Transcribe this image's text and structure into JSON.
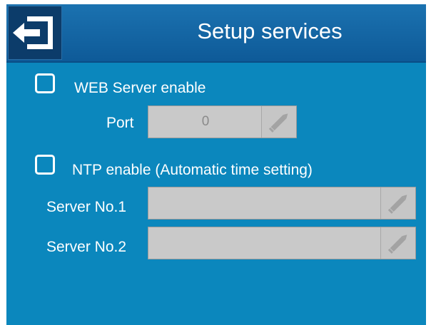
{
  "header": {
    "title": "Setup services",
    "back_icon": "exit-arrow-icon"
  },
  "web_server": {
    "checkbox_checked": false,
    "label": "WEB Server enable",
    "port_label": "Port",
    "port_value": "0"
  },
  "ntp": {
    "checkbox_checked": false,
    "label": "NTP enable (Automatic time setting)",
    "server1_label": "Server No.1",
    "server1_value": "",
    "server2_label": "Server No.2",
    "server2_value": ""
  },
  "icons": {
    "edit": "pencil-icon"
  },
  "colors": {
    "background": "#0b87bd",
    "header": "#1b72b0",
    "field": "#c9c9c9"
  }
}
